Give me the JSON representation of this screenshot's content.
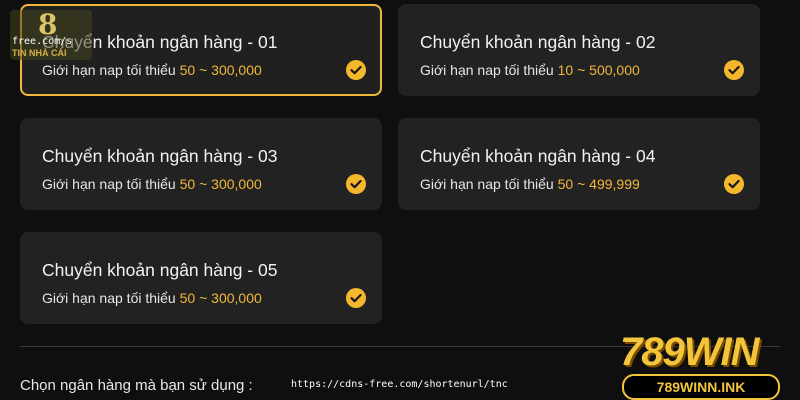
{
  "bank_options": [
    {
      "title": "Chuyển khoản ngân hàng - 01",
      "limit_label": "Giới hạn nap tối thiểu",
      "min": "50",
      "separator": "~",
      "max": "300,000",
      "selected": true
    },
    {
      "title": "Chuyển khoản ngân hàng - 02",
      "limit_label": "Giới hạn nap tối thiểu",
      "min": "10",
      "separator": "~",
      "max": "500,000",
      "selected": false
    },
    {
      "title": "Chuyển khoản ngân hàng - 03",
      "limit_label": "Giới hạn nap tối thiểu",
      "min": "50",
      "separator": "~",
      "max": "300,000",
      "selected": false
    },
    {
      "title": "Chuyển khoản ngân hàng - 04",
      "limit_label": "Giới hạn nap tối thiểu",
      "min": "50",
      "separator": "~",
      "max": "499,999",
      "selected": false
    },
    {
      "title": "Chuyển khoản ngân hàng - 05",
      "limit_label": "Giới hạn nap tối thiểu",
      "min": "50",
      "separator": "~",
      "max": "300,000",
      "selected": false
    }
  ],
  "select_bank_label": "Chọn ngân hàng mà bạn sử dụng :",
  "watermark": {
    "top_left_digit": "8",
    "top_left_text": "free.com/s",
    "top_left_name": "TIN NHÀ CÁI",
    "url": "https://cdns-free.com/shortenurl/tnc"
  },
  "brand": {
    "logo_text": "789WIN",
    "site": "789WINN.INK"
  },
  "colors": {
    "accent": "#f0b73a",
    "card_bg": "#222222",
    "page_bg": "#0f0f0f",
    "check": "#f5b82c"
  },
  "icons": {
    "check": "check-circle-icon"
  }
}
